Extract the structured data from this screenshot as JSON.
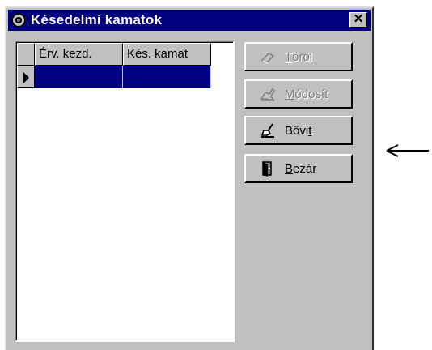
{
  "window": {
    "title": "Késedelmi kamatok",
    "close_label": "✕"
  },
  "grid": {
    "columns": [
      "Érv. kezd.",
      "Kés. kamat"
    ],
    "rows": [
      [
        "",
        ""
      ]
    ],
    "selected_row": 0
  },
  "buttons": {
    "torol": {
      "mnemonic": "T",
      "rest": "öröl",
      "enabled": false,
      "icon": "eraser-icon"
    },
    "modosit": {
      "mnemonic": "M",
      "rest": "ódosít",
      "enabled": false,
      "icon": "edit-hand-icon"
    },
    "bovit": {
      "pre": "Bővi",
      "mnemonic": "t",
      "rest": "",
      "enabled": true,
      "icon": "add-hand-icon"
    },
    "bezar": {
      "mnemonic": "B",
      "rest": "ezár",
      "enabled": true,
      "icon": "door-icon"
    }
  },
  "annotation": {
    "icon": "left-arrow-icon"
  }
}
